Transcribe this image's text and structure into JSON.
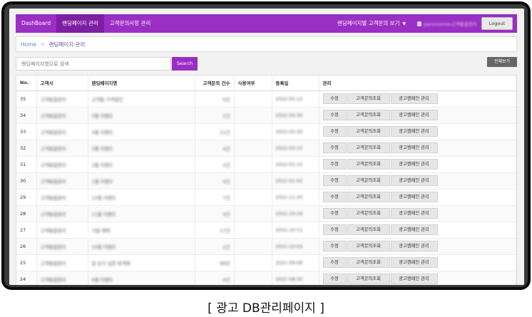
{
  "navbar": {
    "brand": "DashBoard",
    "tabs": [
      {
        "label": "랜딩페이지 관리"
      },
      {
        "label": "고객문의사항 관리"
      }
    ],
    "inquiry_dropdown": "랜딩페이지별 고객문의 보기",
    "user_label": "panonomon고객통합관리",
    "logout_label": "Logout",
    "accent_color": "#9b2ec4"
  },
  "breadcrumb": {
    "home": "Home",
    "current": "랜딩페이지 관리"
  },
  "search": {
    "placeholder": "랜딩페이지명으로 검색",
    "button_label": "Search",
    "view_all_label": "전체보기"
  },
  "table": {
    "headers": [
      "No.",
      "고객사",
      "랜딩페이지명",
      "고객문의 건수",
      "사용여부",
      "등록일",
      "관리"
    ],
    "action_labels": {
      "edit": "수정",
      "inquiry": "고객문의조회",
      "ad_campaign": "광고캠페인 관리"
    },
    "rows": [
      {
        "no": "35",
        "customer": "고객통합관리",
        "page": "고객통 가격할인",
        "count": "0건",
        "use": "",
        "date": "2022-05-12"
      },
      {
        "no": "34",
        "customer": "고객통합관리",
        "page": "3월 이벤트",
        "count": "2건",
        "use": "",
        "date": "2022-04-30"
      },
      {
        "no": "33",
        "customer": "고객통합관리",
        "page": "4월 이벤트",
        "count": "11건",
        "use": "",
        "date": "2022-03-30"
      },
      {
        "no": "32",
        "customer": "고객통합관리",
        "page": "3월 이벤트",
        "count": "4건",
        "use": "",
        "date": "2022-02-10"
      },
      {
        "no": "31",
        "customer": "고객통합관리",
        "page": "2월 이벤트",
        "count": "2건",
        "use": "",
        "date": "2022-01-15"
      },
      {
        "no": "30",
        "customer": "고객통합관리",
        "page": "1월 이벤트",
        "count": "4건",
        "use": "",
        "date": "2022-01-02"
      },
      {
        "no": "29",
        "customer": "고객통합관리",
        "page": "12월 이벤트",
        "count": "7건",
        "use": "",
        "date": "2021-11-20"
      },
      {
        "no": "28",
        "customer": "고객통합관리",
        "page": "11월 이벤트",
        "count": "4건",
        "use": "",
        "date": "2021-10-16"
      },
      {
        "no": "27",
        "customer": "고객통합관리",
        "page": "가을 혜택",
        "count": "17건",
        "use": "",
        "date": "2021-10-11"
      },
      {
        "no": "26",
        "customer": "고객통합관리",
        "page": "10월 이벤트",
        "count": "2건",
        "use": "",
        "date": "2021-10-04"
      },
      {
        "no": "25",
        "customer": "고객통합관리",
        "page": "할 상기 실콘 파격혜",
        "count": "99건",
        "use": "",
        "date": "2021-09-06"
      },
      {
        "no": "24",
        "customer": "고객통합관리",
        "page": "9월 이벤트",
        "count": "4건",
        "use": "",
        "date": "2021-08-30"
      }
    ]
  },
  "caption": "[ 광고 DB관리페이지 ]"
}
